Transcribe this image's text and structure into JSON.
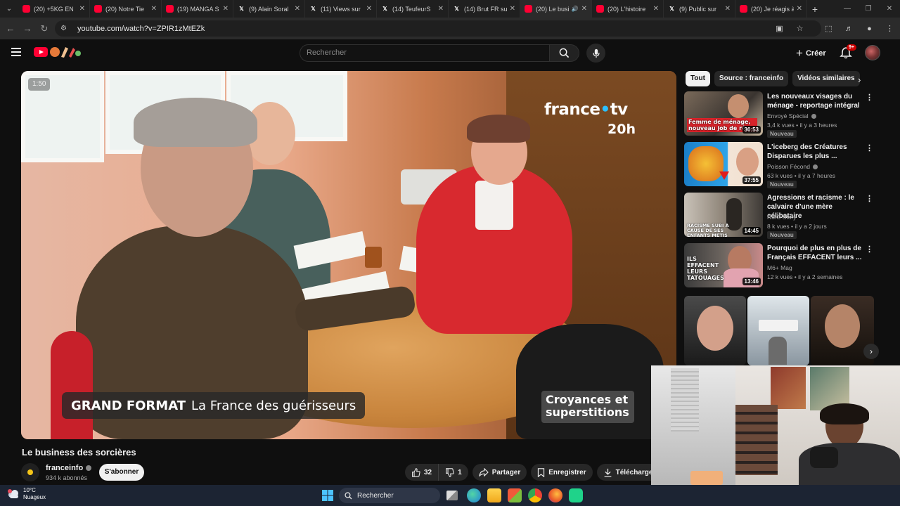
{
  "tabs": [
    {
      "title": "(20) +5KG EN",
      "icon": "youtube-icon",
      "active": false
    },
    {
      "title": "(20) Notre Tie",
      "icon": "youtube-icon",
      "active": false
    },
    {
      "title": "(19) MANGA S",
      "icon": "youtube-icon",
      "active": false
    },
    {
      "title": "(9) Alain Soral",
      "icon": "x-icon",
      "active": false
    },
    {
      "title": "(11) Views sur",
      "icon": "x-icon",
      "active": false
    },
    {
      "title": "(14) TeufeurS",
      "icon": "x-icon",
      "active": false
    },
    {
      "title": "(14) Brut FR su",
      "icon": "x-icon",
      "active": false
    },
    {
      "title": "(20) Le busi",
      "icon": "youtube-icon",
      "active": true
    },
    {
      "title": "(20) L'histoire",
      "icon": "youtube-icon",
      "active": false
    },
    {
      "title": "(9) Public sur",
      "icon": "x-icon",
      "active": false
    },
    {
      "title": "(20) Je réagis à",
      "icon": "youtube-icon",
      "active": false
    }
  ],
  "address": {
    "url": "youtube.com/watch?v=ZPIR1zMtEZk"
  },
  "header": {
    "search_placeholder": "Rechercher",
    "create_label": "Créer",
    "notif_count": "9+"
  },
  "player": {
    "timer": "1:50",
    "logo_text": "france",
    "logo_tv": "tv",
    "logo_dot": "•",
    "logo_20h": "20h",
    "lower_third_bold": "GRAND FORMAT",
    "lower_third_text": "La France des guérisseurs",
    "badge_line1": "Croyances et",
    "badge_line2": "superstitions"
  },
  "video": {
    "title": "Le business des sorcières",
    "channel": "franceinfo",
    "subscribers": "934 k abonnés",
    "subscribe_label": "S'abonner",
    "likes": "32",
    "dislikes": "1",
    "share_label": "Partager",
    "save_label": "Enregistrer",
    "download_label": "Télécharger"
  },
  "chips": [
    "Tout",
    "Source : franceinfo",
    "Vidéos similaires"
  ],
  "recommendations": [
    {
      "title": "Les nouveaux visages du ménage - reportage intégral",
      "channel": "Envoyé Spécial",
      "verified": true,
      "meta": "3,4 k vues • il y a 3 heures",
      "badge": "Nouveau",
      "duration": "30:53",
      "thumb_text": "Femme de ménage, nouveau job de rêv"
    },
    {
      "title": "L'iceberg des Créatures Disparues les plus ...",
      "channel": "Poisson Fécond",
      "verified": true,
      "meta": "63 k vues • il y a 7 heures",
      "badge": "Nouveau",
      "duration": "37:55",
      "thumb_text": ""
    },
    {
      "title": "Agressions et racisme : le calvaire d'une mère célibataire",
      "channel": "RMC Story",
      "verified": false,
      "meta": "8 k vues • il y a 2 jours",
      "badge": "Nouveau",
      "duration": "14:45",
      "thumb_text": "RACISME SUBI À CAUSE DE SES ENFANTS MÉTIS"
    },
    {
      "title": "Pourquoi de plus en plus de Français EFFACENT leurs ...",
      "channel": "M6+ Mag",
      "verified": false,
      "meta": "12 k vues • il y a 2 semaines",
      "badge": "",
      "duration": "13:46",
      "thumb_text": "ILS EFFACENT LEURS TATOUAGES"
    }
  ],
  "taskbar": {
    "temperature": "10°C",
    "weather": "Nuageux",
    "search_label": "Rechercher"
  }
}
